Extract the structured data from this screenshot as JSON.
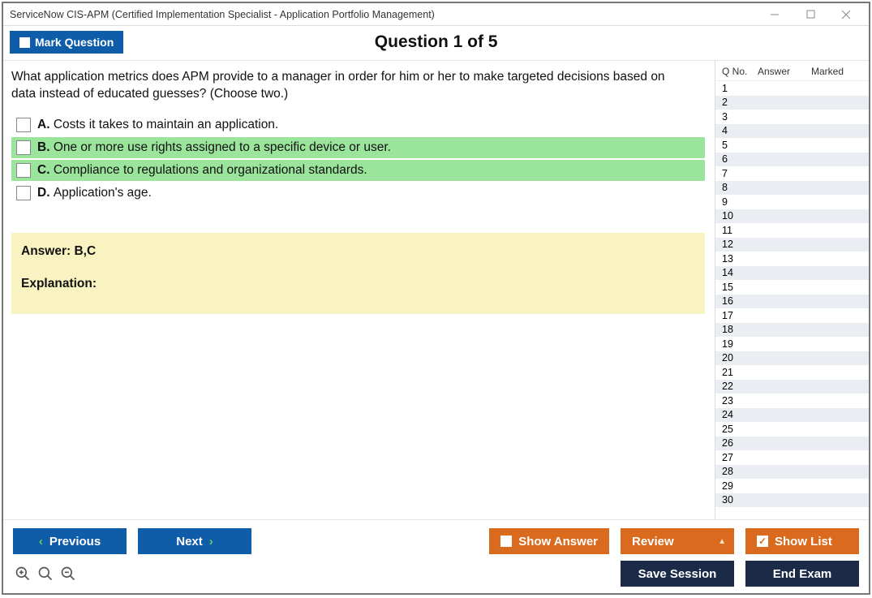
{
  "window": {
    "title": "ServiceNow CIS-APM (Certified Implementation Specialist - Application Portfolio Management)"
  },
  "header": {
    "mark_label": "Mark Question",
    "heading": "Question 1 of 5"
  },
  "question": {
    "text": "What application metrics does APM provide to a manager in order for him or her to make targeted decisions based on data instead of educated guesses? (Choose two.)",
    "choices": [
      {
        "letter": "A.",
        "text": "Costs it takes to maintain an application.",
        "highlight": false
      },
      {
        "letter": "B.",
        "text": "One or more use rights assigned to a specific device or user.",
        "highlight": true
      },
      {
        "letter": "C.",
        "text": "Compliance to regulations and organizational standards.",
        "highlight": true
      },
      {
        "letter": "D.",
        "text": "Application's age.",
        "highlight": false
      }
    ]
  },
  "answer_panel": {
    "answer_line": "Answer: B,C",
    "explanation_label": "Explanation:"
  },
  "side": {
    "col_q": "Q No.",
    "col_a": "Answer",
    "col_m": "Marked",
    "rows": [
      1,
      2,
      3,
      4,
      5,
      6,
      7,
      8,
      9,
      10,
      11,
      12,
      13,
      14,
      15,
      16,
      17,
      18,
      19,
      20,
      21,
      22,
      23,
      24,
      25,
      26,
      27,
      28,
      29,
      30
    ]
  },
  "footer": {
    "previous": "Previous",
    "next": "Next",
    "show_answer": "Show Answer",
    "review": "Review",
    "show_list": "Show List",
    "save_session": "Save Session",
    "end_exam": "End Exam"
  }
}
